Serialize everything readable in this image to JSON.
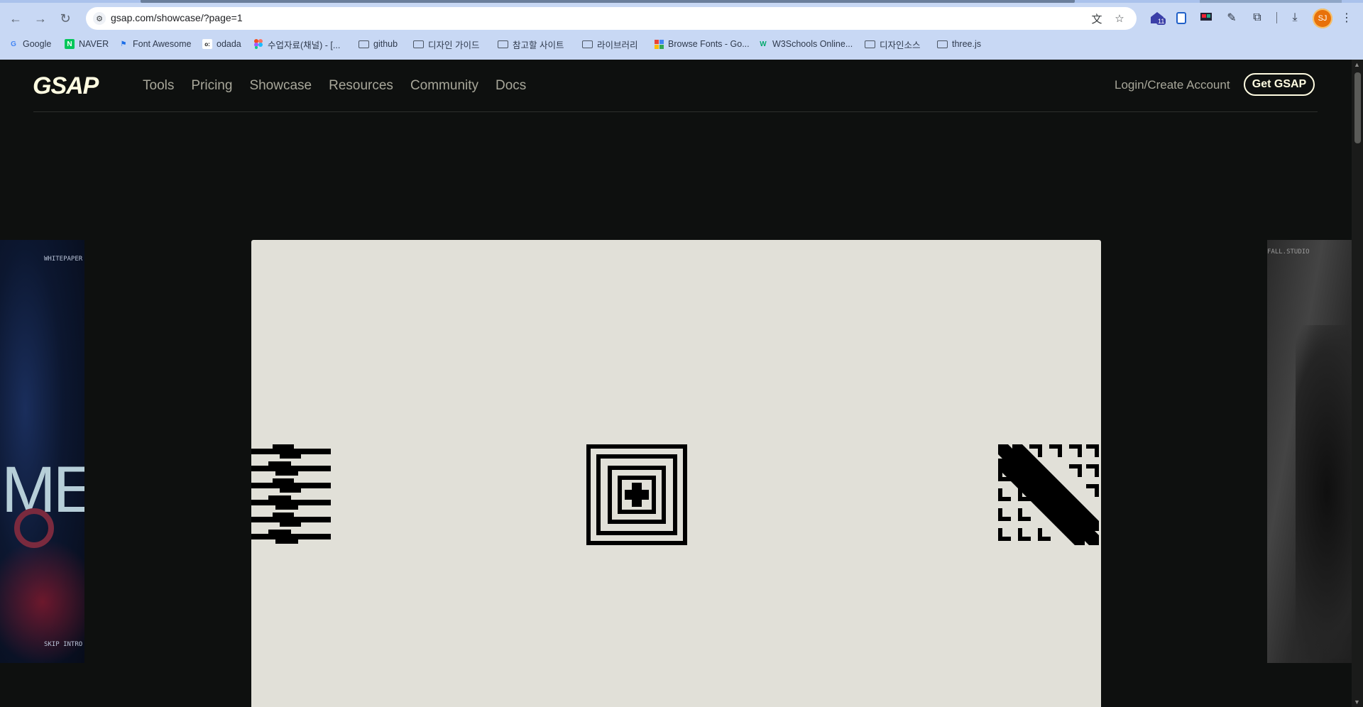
{
  "browser": {
    "url": "gsap.com/showcase/?page=1",
    "profile_initials": "SJ",
    "extension_badge": "11",
    "bookmarks": [
      {
        "label": "Google",
        "icon": "google-icon"
      },
      {
        "label": "NAVER",
        "icon": "naver-icon"
      },
      {
        "label": "Font Awesome",
        "icon": "font-awesome-icon"
      },
      {
        "label": "odada",
        "icon": "odada-icon"
      },
      {
        "label": "수업자료(채널) - [...",
        "icon": "figma-icon"
      },
      {
        "label": "github",
        "icon": "folder-icon"
      },
      {
        "label": "디자인 가이드",
        "icon": "folder-icon"
      },
      {
        "label": "참고할 사이트",
        "icon": "folder-icon"
      },
      {
        "label": "라이브러리",
        "icon": "folder-icon"
      },
      {
        "label": "Browse Fonts - Go...",
        "icon": "google-fonts-icon"
      },
      {
        "label": "W3Schools Online...",
        "icon": "w3schools-icon"
      },
      {
        "label": "디자인소스",
        "icon": "folder-icon"
      },
      {
        "label": "three.js",
        "icon": "folder-icon"
      }
    ]
  },
  "header": {
    "logo": "GSAP",
    "nav": [
      "Tools",
      "Pricing",
      "Showcase",
      "Resources",
      "Community",
      "Docs"
    ],
    "login": "Login/Create Account",
    "cta": "Get GSAP"
  },
  "showcase": {
    "left_card": {
      "top_text": "WHITEPAPER",
      "big_text": "ME",
      "bottom_text": "SKIP INTRO"
    },
    "right_card": {
      "top_text": "FALL.STUDIO"
    }
  },
  "colors": {
    "page_bg": "#0e100f",
    "cream": "#fffce1",
    "card_bg": "#e1e0d8"
  }
}
